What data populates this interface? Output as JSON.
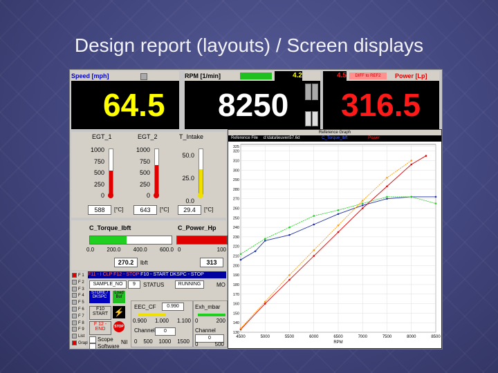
{
  "slide": {
    "title": "Design report (layouts) / Screen displays"
  },
  "speed": {
    "label": "Speed [mph]",
    "value": "64.5"
  },
  "rpm": {
    "label": "RPM [1/min]",
    "value": "8250",
    "small_value": "4.2"
  },
  "power": {
    "label": "Power [Lp]",
    "value": "316.5",
    "diff_value": "4.5",
    "diff_label": "DIFF to REF2"
  },
  "temps": {
    "labels": [
      "EGT_1",
      "EGT_2",
      "T_Intake"
    ],
    "egt1_ticks": [
      "1000",
      "750",
      "500",
      "250",
      "0"
    ],
    "egt2_ticks": [
      "1000",
      "750",
      "500",
      "250",
      "0"
    ],
    "intake_ticks": [
      "50.0",
      "25.0",
      "0.0"
    ],
    "values": [
      "588",
      "643",
      "29.4"
    ],
    "units": [
      "[°C]",
      "[°C]",
      "[°C]"
    ]
  },
  "torque": {
    "label": "C_Torque_lbft",
    "ticks": [
      "0.0",
      "200.0",
      "400.0",
      "600.0"
    ],
    "value": "270.2",
    "unit": "lbft",
    "fill": 0.45
  },
  "power_bar": {
    "label": "C_Power_Hp",
    "ticks": [
      "0",
      "100"
    ],
    "value": "313",
    "fill": 1.0
  },
  "funcbar": {
    "text1": "F11 - I CLP",
    "text2": "F12 - STOP",
    "text3": "F10 - START",
    "text4": "DKSPC - STOP"
  },
  "fkeys": [
    "F 1",
    "F 2",
    "F 3",
    "F 4",
    "F 5",
    "F 6",
    "F 7",
    "F 8",
    "F 9",
    "List",
    "Graph"
  ],
  "controls": {
    "sample_label": "SAMPLE_NO",
    "sample_value": "9",
    "status_label": "STATUS",
    "status_value": "RUNNING",
    "mo": "MO",
    "store_label": "STORE / DKSPC",
    "fun_label": "Load Buf",
    "f10_label": "F10 START",
    "f12_label": "F 12 - END",
    "eec_label": "EEC_CF",
    "eec_value": "0.990",
    "exh_label": "Exh_mbar",
    "scale1": [
      "0.900",
      "1.000",
      "1.100"
    ],
    "scale2": [
      "0",
      "200"
    ],
    "channel1_label": "Channel",
    "channel1_value": "0",
    "channel2_label": "Channel",
    "channel2_value": "0",
    "scope_label": "Scope",
    "software_label": "Software",
    "axis1": [
      "0",
      "500",
      "1000",
      "1500"
    ],
    "axis2": [
      "0",
      "500"
    ],
    "nil": "Nil"
  },
  "graph_window": {
    "title": "Reference Graph",
    "ref_label": "Reference File",
    "ref_path": "d:\\data\\leuven57.6d",
    "series1_label": "C_Torque_lbft",
    "series2_label": "Power",
    "xlabel": "RPM"
  },
  "chart_data": {
    "type": "line",
    "xlabel": "RPM",
    "x_ticks": [
      "4500",
      "5000",
      "5500",
      "6000",
      "6500",
      "7000",
      "7500",
      "8000",
      "8500"
    ],
    "y_ticks": [
      "325",
      "320",
      "310",
      "300",
      "290",
      "280",
      "270",
      "260",
      "250",
      "240",
      "230",
      "220",
      "210",
      "200",
      "190",
      "180",
      "170",
      "160",
      "150",
      "140",
      "130"
    ],
    "xlim": [
      4500,
      8500
    ],
    "ylim": [
      130,
      327
    ],
    "series": [
      {
        "name": "C_Torque_lbft",
        "color": "#1f2fa8",
        "x": [
          4500,
          4800,
          5000,
          5500,
          6000,
          6500,
          7000,
          7500,
          8000,
          8500
        ],
        "y": [
          206,
          215,
          226,
          232,
          243,
          254,
          263,
          270,
          272,
          272
        ]
      },
      {
        "name": "Power",
        "color": "#e00000",
        "x": [
          4500,
          5000,
          5500,
          6000,
          6500,
          7000,
          7500,
          8000,
          8300
        ],
        "y": [
          133,
          160,
          185,
          210,
          235,
          260,
          283,
          306,
          315
        ]
      },
      {
        "color": "#20d020",
        "x": [
          4500,
          5000,
          5500,
          6000,
          6500,
          7000,
          7500,
          8000,
          8500
        ],
        "y": [
          212,
          228,
          240,
          252,
          258,
          265,
          272,
          272,
          265
        ]
      },
      {
        "color": "#ff9a00",
        "x": [
          4500,
          5000,
          5500,
          6000,
          6500,
          7000,
          7500,
          8000
        ],
        "y": [
          134,
          162,
          190,
          216,
          242,
          268,
          292,
          310
        ]
      }
    ]
  }
}
